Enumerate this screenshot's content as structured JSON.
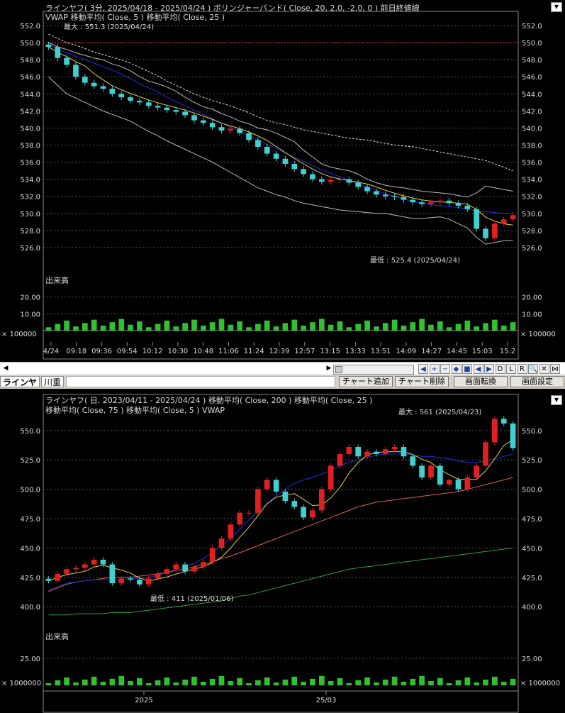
{
  "top_chart": {
    "header_line1": "ラインヤフ( 3分, 2025/04/18 - 2025/04/24 )   ボリンジャーバンド( Close, 20, 2.0, -2.0, 0 )   前日終値線",
    "header_line2": "VWAP   移動平均( Close, 5 )   移動平均( Close, 25 )",
    "max_label": "最大 : 551.3 (2025/04/24)",
    "min_label": "最低 : 525.4 (2025/04/24)",
    "volume_label": "出来高",
    "volume_scale_left": "× 100000",
    "volume_scale_right": "× 100000"
  },
  "bottom_chart": {
    "header_line1": "ラインヤフ( 日, 2023/04/11 - 2025/04/24 )   移動平均( Close, 200 )   移動平均( Close, 25 )",
    "header_line2": "移動平均( Close, 75 )   移動平均( Close, 5 )   VWAP",
    "max_label": "最大 : 561 (2025/04/23)",
    "min_label": "最低 : 411 (2025/01/06)",
    "volume_label": "出来高",
    "volume_scale_left": "× 1000000",
    "volume_scale_right": "× 1000000"
  },
  "toolbar": {
    "tab_active": "ラインヤフ",
    "tab_other": "川重",
    "add_chart": "チャート追加",
    "delete_chart": "チャート削除",
    "switch_screen": "画面転換",
    "screen_settings": "画面設定"
  },
  "nav_buttons": [
    "◀",
    "+",
    "−",
    "◆",
    "■",
    "◀",
    "▶",
    "D",
    "L",
    "R",
    "🔍",
    "✕",
    "⋈"
  ],
  "colors": {
    "background": "#000000",
    "up_candle": "#e02020",
    "down_candle": "#40d0d0",
    "ma_short": "#e8d040",
    "ma_blue": "#2030e0",
    "ma_red": "#e06050",
    "ma_green": "#30a040",
    "volume": "#30c030",
    "prev_close": "#d03030",
    "bollinger": "#bbbbbb"
  },
  "chart_data": [
    {
      "type": "candlestick",
      "title": "ラインヤフ( 3分, 2025/04/18 - 2025/04/24 )",
      "ylim": [
        525,
        552.5
      ],
      "yticks": [
        552.0,
        550.0,
        548.0,
        546.0,
        544.0,
        542.0,
        540.0,
        538.0,
        536.0,
        534.0,
        532.0,
        530.0,
        528.0,
        526.0
      ],
      "xticks": [
        "4/24",
        "09:18",
        "09:36",
        "09:54",
        "10:12",
        "10:30",
        "10:48",
        "11:06",
        "11:24",
        "12:39",
        "12:57",
        "13:15",
        "13:33",
        "13:51",
        "14:09",
        "14:27",
        "14:45",
        "15:03",
        "15:2"
      ],
      "previous_close": 550.0,
      "max": 551.3,
      "min": 525.4,
      "close": [
        549.5,
        548.2,
        547.4,
        546.0,
        545.3,
        544.9,
        544.6,
        544.0,
        543.6,
        543.2,
        543.0,
        542.6,
        542.4,
        542.1,
        541.9,
        541.5,
        540.9,
        540.6,
        540.1,
        539.7,
        539.9,
        539.4,
        538.6,
        537.8,
        537.0,
        536.4,
        535.8,
        535.2,
        534.6,
        534.0,
        533.7,
        533.9,
        534.0,
        533.6,
        533.1,
        532.6,
        532.2,
        532.0,
        531.9,
        531.6,
        531.3,
        531.1,
        531.3,
        531.5,
        531.2,
        530.9,
        530.5,
        528.2,
        527.1,
        528.8,
        529.3,
        529.8
      ],
      "bollinger_upper": [
        550.0,
        549.5,
        549.2,
        548.8,
        548.5,
        548.2,
        548.0,
        547.5,
        547.2,
        546.7,
        546.0,
        545.5,
        545.2,
        544.8,
        544.3,
        543.6,
        543.0,
        542.5,
        542.2,
        541.7,
        541.3,
        540.8,
        540.5,
        540.0,
        539.8,
        539.4,
        538.9,
        538.4,
        537.4,
        536.6,
        535.8,
        535.4,
        535.2,
        535.0,
        534.6,
        534.0,
        533.6,
        533.3,
        533.1,
        533.0,
        532.8,
        532.6,
        532.5,
        532.4,
        532.3,
        532.1,
        531.9,
        532.4,
        533.2,
        533.0,
        532.8,
        532.6
      ],
      "bollinger_lower": [
        546.0,
        545.0,
        544.0,
        543.5,
        543.0,
        542.5,
        542.0,
        541.6,
        541.2,
        540.8,
        540.2,
        539.6,
        539.1,
        538.5,
        538.0,
        537.5,
        537.0,
        536.5,
        536.0,
        535.4,
        534.8,
        534.2,
        533.6,
        533.0,
        532.6,
        532.2,
        531.9,
        531.5,
        531.2,
        531.0,
        530.8,
        530.6,
        530.4,
        530.3,
        530.2,
        530.1,
        530.0,
        530.0,
        529.8,
        529.6,
        529.4,
        529.4,
        529.5,
        529.6,
        529.3,
        528.8,
        528.3,
        527.2,
        526.4,
        526.6,
        526.8,
        526.8
      ],
      "vwap": [
        551.0,
        550.5,
        550.0,
        549.7,
        549.3,
        548.9,
        548.6,
        548.3,
        548.0,
        547.6,
        547.1,
        546.6,
        546.1,
        545.5,
        545.0,
        544.5,
        544.0,
        543.6,
        543.2,
        542.9,
        542.6,
        542.2,
        541.8,
        541.3,
        540.9,
        540.6,
        540.4,
        540.1,
        539.8,
        539.6,
        539.4,
        539.2,
        539.0,
        538.8,
        538.7,
        538.6,
        538.4,
        538.2,
        538.0,
        537.9,
        537.8,
        537.6,
        537.4,
        537.2,
        537.0,
        536.8,
        536.6,
        536.4,
        536.2,
        535.8,
        535.4,
        535.0
      ],
      "ma25": [
        549.8,
        549.3,
        548.8,
        548.4,
        548.0,
        547.6,
        547.2,
        546.8,
        546.3,
        545.8,
        545.2,
        544.7,
        544.2,
        543.6,
        543.1,
        542.6,
        542.1,
        541.6,
        541.1,
        540.6,
        540.1,
        539.6,
        539.1,
        538.6,
        538.1,
        537.6,
        537.1,
        536.6,
        536.1,
        535.6,
        535.1,
        534.7,
        534.3,
        533.9,
        533.5,
        533.1,
        532.7,
        532.3,
        532.0,
        531.7,
        531.4,
        531.2,
        531.0,
        530.9,
        530.8,
        530.7,
        530.5,
        530.3,
        530.2,
        530.1,
        530.0,
        530.0
      ],
      "volume_yticks": [
        20.0,
        10.0
      ],
      "volume_ylim": [
        0,
        30
      ]
    },
    {
      "type": "candlestick",
      "title": "ラインヤフ( 日, 2023/04/11 - 2025/04/24 )",
      "ylim": [
        385,
        565
      ],
      "yticks": [
        550,
        525,
        500,
        475,
        450,
        425,
        400
      ],
      "xticks": [
        "2025",
        "25/03"
      ],
      "max": 561,
      "min": 411,
      "close": [
        422,
        428,
        432,
        433,
        436,
        440,
        436,
        420,
        424,
        423,
        419,
        424,
        428,
        432,
        436,
        430,
        434,
        438,
        450,
        458,
        470,
        480,
        480,
        500,
        508,
        498,
        490,
        485,
        476,
        482,
        500,
        520,
        530,
        536,
        528,
        532,
        530,
        534,
        536,
        528,
        520,
        510,
        520,
        504,
        508,
        500,
        510,
        520,
        540,
        560,
        556,
        535
      ],
      "ma25": [
        414,
        417,
        420,
        421,
        422,
        423,
        423,
        423,
        423,
        424,
        424,
        425,
        427,
        429,
        432,
        434,
        437,
        441,
        446,
        452,
        458,
        466,
        474,
        481,
        488,
        494,
        500,
        505,
        508,
        510,
        513,
        516,
        520,
        523,
        525,
        527,
        529,
        530,
        530,
        530,
        529,
        528,
        528,
        527,
        526,
        524,
        523,
        523,
        524,
        526,
        528,
        530
      ],
      "ma75": [
        413,
        416,
        419,
        421,
        422,
        423,
        424,
        425,
        425,
        425,
        426,
        427,
        428,
        429,
        431,
        432,
        434,
        436,
        438,
        441,
        443,
        446,
        449,
        452,
        455,
        458,
        461,
        464,
        467,
        470,
        473,
        476,
        479,
        482,
        485,
        487,
        489,
        490,
        491,
        492,
        493,
        494,
        495,
        496,
        497,
        498,
        500,
        502,
        504,
        506,
        508,
        510
      ],
      "ma200": [
        393,
        393,
        393,
        394,
        394,
        394,
        394,
        395,
        395,
        395,
        396,
        397,
        398,
        399,
        400,
        401,
        402,
        403,
        404,
        405,
        407,
        409,
        410,
        412,
        414,
        416,
        418,
        420,
        422,
        424,
        426,
        428,
        430,
        432,
        433,
        434,
        435,
        436,
        437,
        438,
        439,
        440,
        441,
        442,
        443,
        444,
        445,
        446,
        447,
        448,
        449,
        450
      ],
      "volume_yticks": [
        25.0
      ],
      "volume_ylim": [
        0,
        40
      ]
    }
  ]
}
